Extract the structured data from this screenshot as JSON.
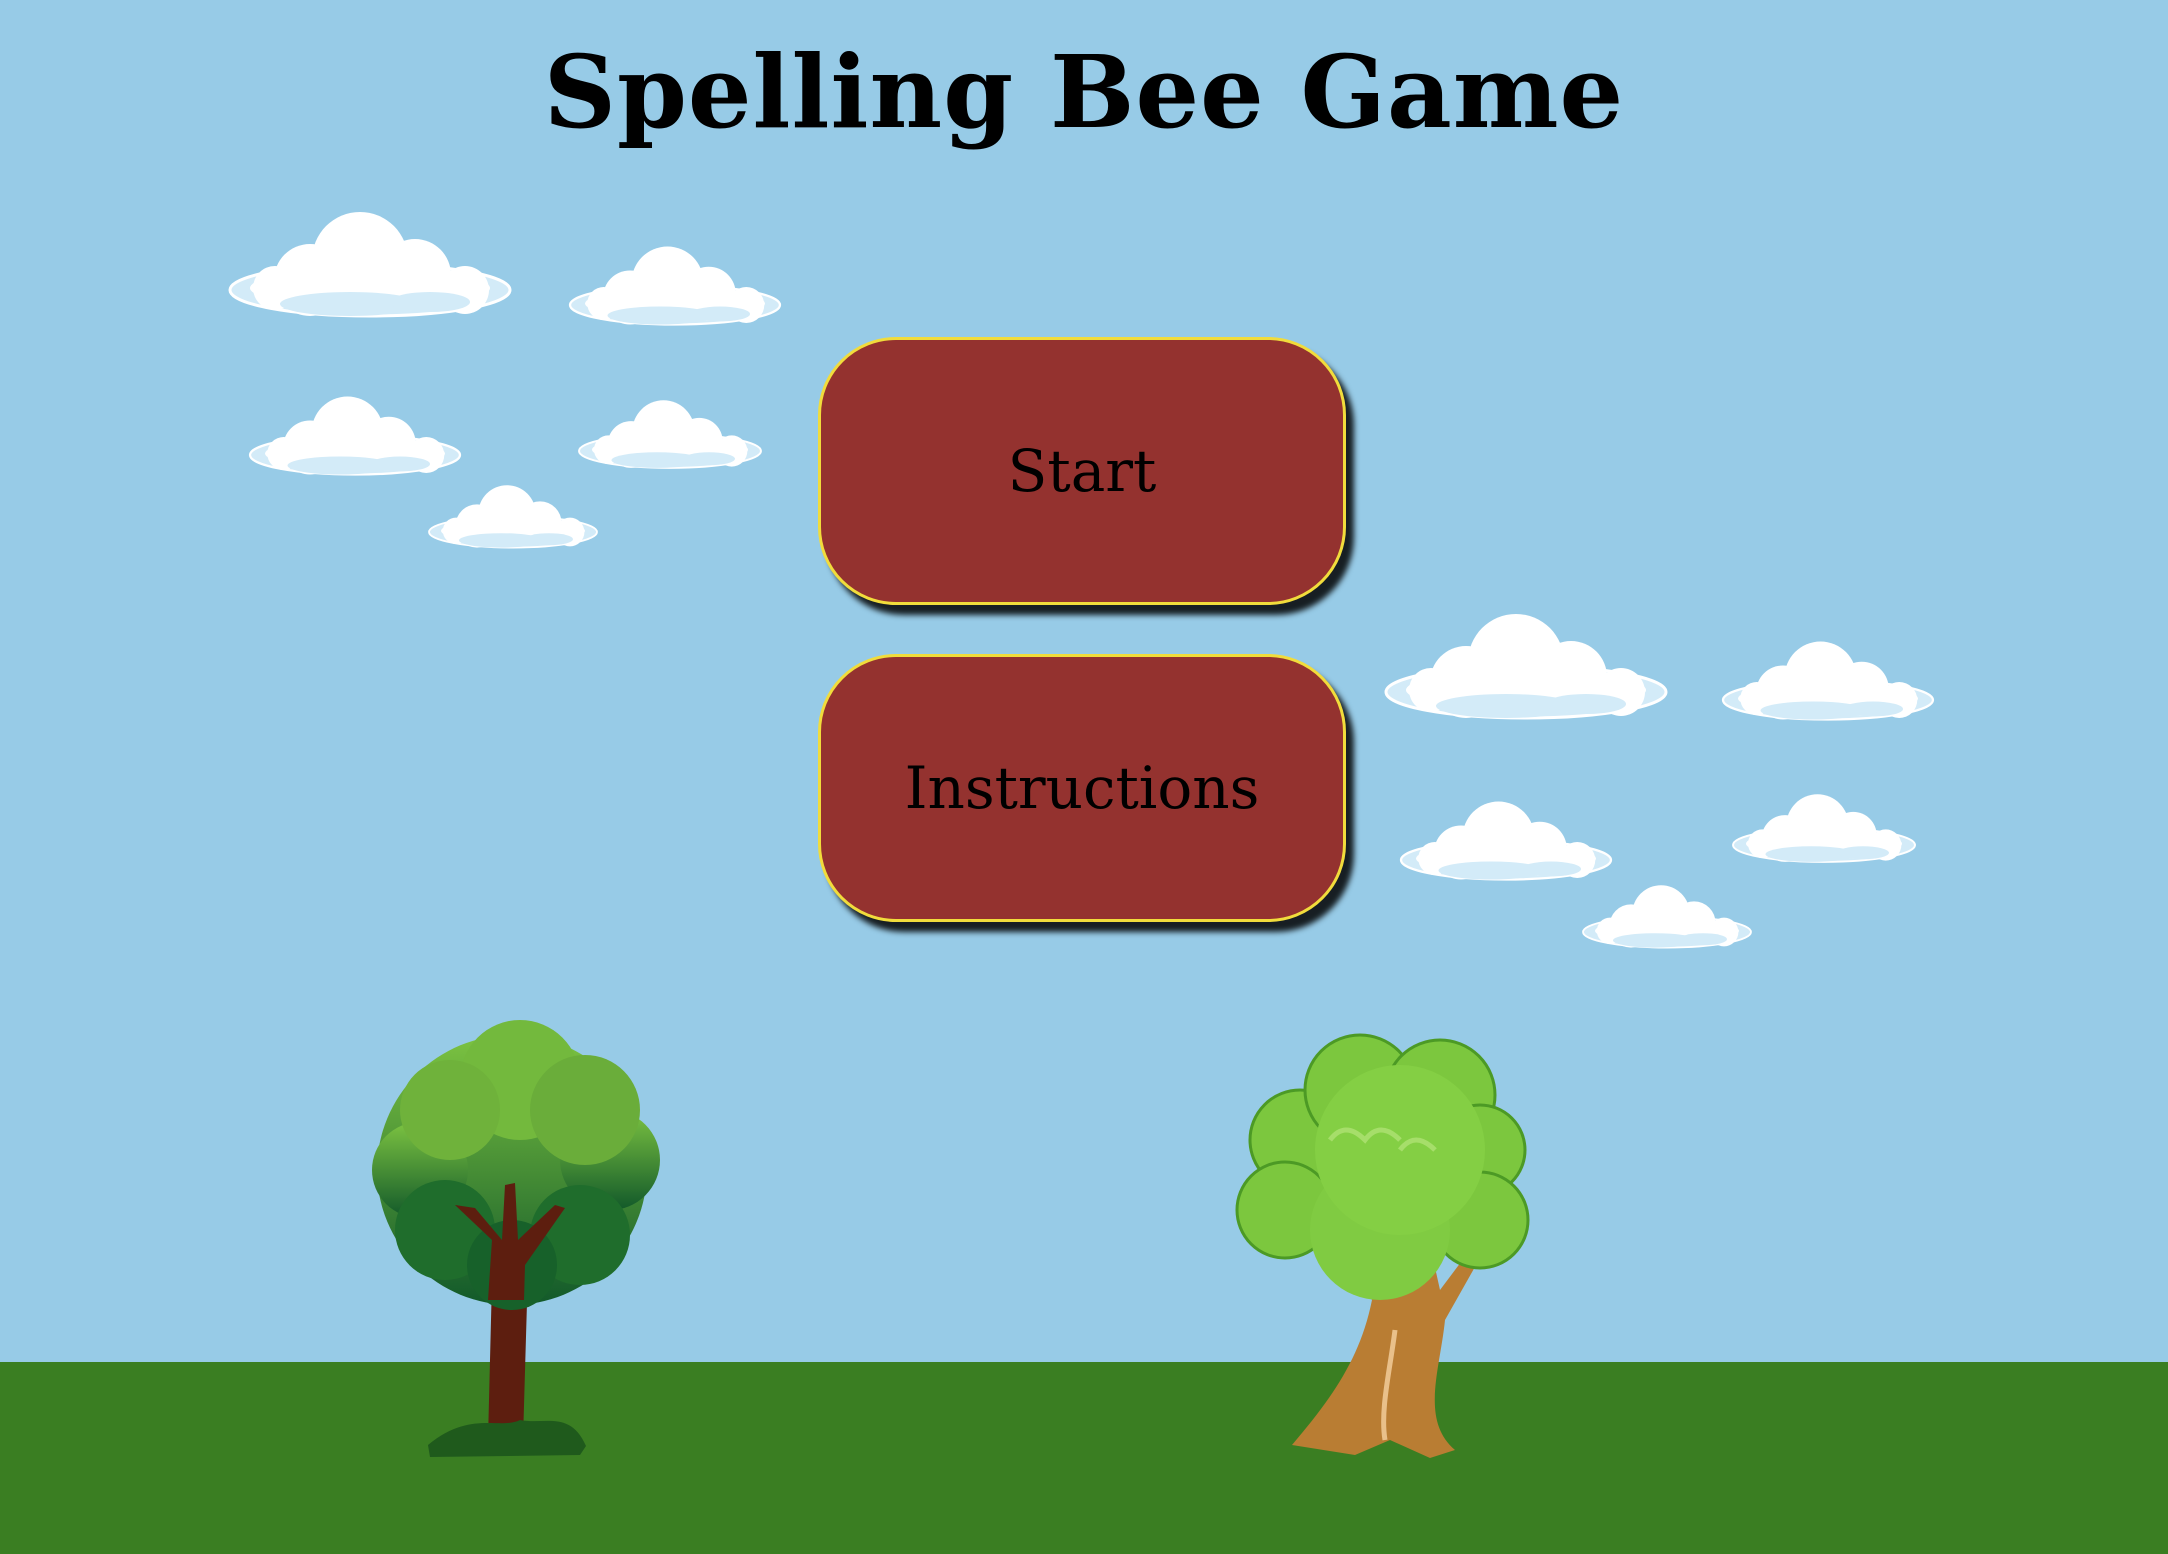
{
  "title": "Spelling Bee Game",
  "menu": {
    "start_label": "Start",
    "instructions_label": "Instructions"
  },
  "colors": {
    "sky": "#97cbe7",
    "ground": "#3a7e22",
    "button_fill": "#94322f",
    "button_border": "#f1dc3c"
  }
}
